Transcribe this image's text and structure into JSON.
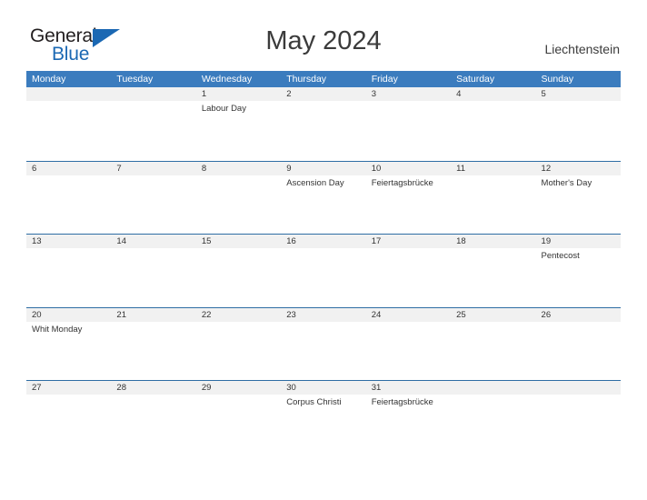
{
  "brand": {
    "name_part1": "General",
    "name_part2": "Blue",
    "triangle_icon": "triangle-icon",
    "primary_color": "#1b68b3"
  },
  "header": {
    "title": "May 2024",
    "country": "Liechtenstein"
  },
  "calendar": {
    "header_bg": "#3b7cbe",
    "date_strip_bg": "#f1f1f1",
    "separator_color": "#2e6da4",
    "weekdays": [
      "Monday",
      "Tuesday",
      "Wednesday",
      "Thursday",
      "Friday",
      "Saturday",
      "Sunday"
    ],
    "weeks": [
      [
        {
          "day": "",
          "event": ""
        },
        {
          "day": "",
          "event": ""
        },
        {
          "day": "1",
          "event": "Labour Day"
        },
        {
          "day": "2",
          "event": ""
        },
        {
          "day": "3",
          "event": ""
        },
        {
          "day": "4",
          "event": ""
        },
        {
          "day": "5",
          "event": ""
        }
      ],
      [
        {
          "day": "6",
          "event": ""
        },
        {
          "day": "7",
          "event": ""
        },
        {
          "day": "8",
          "event": ""
        },
        {
          "day": "9",
          "event": "Ascension Day"
        },
        {
          "day": "10",
          "event": "Feiertagsbrücke"
        },
        {
          "day": "11",
          "event": ""
        },
        {
          "day": "12",
          "event": "Mother's Day"
        }
      ],
      [
        {
          "day": "13",
          "event": ""
        },
        {
          "day": "14",
          "event": ""
        },
        {
          "day": "15",
          "event": ""
        },
        {
          "day": "16",
          "event": ""
        },
        {
          "day": "17",
          "event": ""
        },
        {
          "day": "18",
          "event": ""
        },
        {
          "day": "19",
          "event": "Pentecost"
        }
      ],
      [
        {
          "day": "20",
          "event": "Whit Monday"
        },
        {
          "day": "21",
          "event": ""
        },
        {
          "day": "22",
          "event": ""
        },
        {
          "day": "23",
          "event": ""
        },
        {
          "day": "24",
          "event": ""
        },
        {
          "day": "25",
          "event": ""
        },
        {
          "day": "26",
          "event": ""
        }
      ],
      [
        {
          "day": "27",
          "event": ""
        },
        {
          "day": "28",
          "event": ""
        },
        {
          "day": "29",
          "event": ""
        },
        {
          "day": "30",
          "event": "Corpus Christi"
        },
        {
          "day": "31",
          "event": "Feiertagsbrücke"
        },
        {
          "day": "",
          "event": ""
        },
        {
          "day": "",
          "event": ""
        }
      ]
    ]
  }
}
